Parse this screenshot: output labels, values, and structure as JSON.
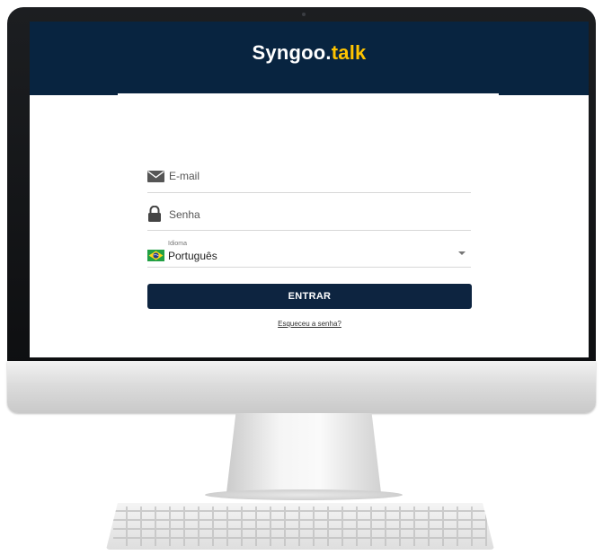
{
  "brand": {
    "name": "Syngoo.",
    "tld": "talk",
    "accent_color": "#ffc400",
    "header_color": "#082440"
  },
  "login": {
    "email_label": "E-mail",
    "email_icon": "envelope-icon",
    "password_label": "Senha",
    "password_icon": "lock-icon",
    "language_caption": "Idioma",
    "language_value": "Português",
    "language_icon": "brazil-flag-icon",
    "submit_label": "ENTRAR",
    "forgot_label": "Esqueceu a senha?"
  }
}
